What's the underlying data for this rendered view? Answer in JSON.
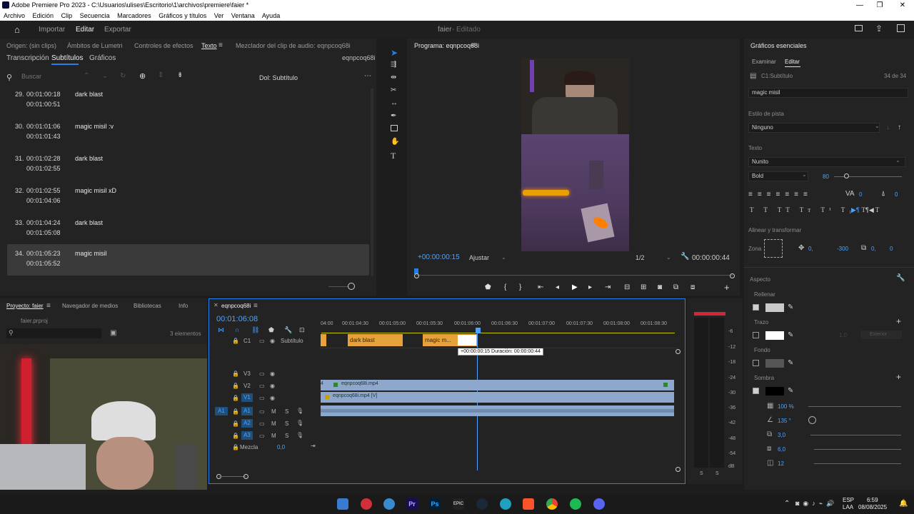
{
  "titlebar": {
    "title": "Adobe Premiere Pro 2023 - C:\\Usuarios\\ulises\\Escritorio\\1\\archivos\\premiere\\faier *"
  },
  "menu": [
    "Archivo",
    "Edición",
    "Clip",
    "Secuencia",
    "Marcadores",
    "Gráficos y títulos",
    "Ver",
    "Ventana",
    "Ayuda"
  ],
  "nav": {
    "importar": "Importar",
    "editar": "Editar",
    "exportar": "Exportar",
    "project": "faier",
    "status": "Editado"
  },
  "upper_tabs": {
    "origen": "Origen: (sin clips)",
    "ambitos": "Ámbitos de Lumetri",
    "controles": "Controles de efectos",
    "texto": "Texto",
    "mezclador": "Mezclador del clip de audio: eqnpcoq68i"
  },
  "text_panel": {
    "tab_transcripcion": "Transcripción",
    "tab_subtitulos": "Subtítulos",
    "tab_graficos": "Gráficos",
    "sequence": "eqnpcoq68i",
    "search_placeholder": "Buscar",
    "track": "Dol: Subtítulo",
    "rows": [
      {
        "num": "29.",
        "start": "00:01:00:18",
        "end": "00:01:00:51",
        "text": "dark blast"
      },
      {
        "num": "30.",
        "start": "00:01:01:06",
        "end": "00:01:01:43",
        "text": "magic misil :v"
      },
      {
        "num": "31.",
        "start": "00:01:02:28",
        "end": "00:01:02:55",
        "text": "dark blast"
      },
      {
        "num": "32.",
        "start": "00:01:02:55",
        "end": "00:01:04:06",
        "text": "magic misil xD"
      },
      {
        "num": "33.",
        "start": "00:01:04:24",
        "end": "00:01:05:08",
        "text": "dark blast"
      },
      {
        "num": "34.",
        "start": "00:01:05:23",
        "end": "00:01:05:52",
        "text": "magic misil"
      }
    ]
  },
  "program": {
    "title": "Programa: eqnpcoq68i",
    "timecode": "+00:00:00:15",
    "fit": "Ajustar",
    "res": "1/2",
    "duration": "00:00:00:44"
  },
  "essential": {
    "title": "Gráficos esenciales",
    "tab_examinar": "Examinar",
    "tab_editar": "Editar",
    "layer": "C1:Subtítulo",
    "count": "34 de 34",
    "layer_text": "magic misil",
    "estilo_label": "Estilo de pista",
    "estilo_value": "Ninguno",
    "texto_label": "Texto",
    "font": "Nunito",
    "weight": "Bold",
    "size": "80",
    "align_label": "Alinear y transformar",
    "zona": "Zona",
    "pos_x": "0,",
    "pos_y": "-300",
    "rot": "0,",
    "opacity": "0",
    "aspecto": "Aspecto",
    "rellenar": "Rellenar",
    "trazo": "Trazo",
    "fondo": "Fondo",
    "sombra": "Sombra",
    "shadow_opacity": "100 %",
    "shadow_angle": "135 °",
    "shadow_dist": "3,0",
    "shadow_size": "6,0",
    "shadow_blur": "12",
    "trazo_val": "1,0",
    "trazo_pos": "Exterior",
    "num_left": "0",
    "num_tab": "0",
    "colors": {
      "fill": "#c9c9c9",
      "stroke": "#ffffff",
      "bg": "#555555",
      "shadow": "#000000"
    }
  },
  "project_panel": {
    "tab_proyecto": "Proyecto: faier",
    "tab_nav": "Navegador de medios",
    "tab_bib": "Bibliotecas",
    "tab_info": "Info",
    "file": "faier.prproj",
    "count": "3 elementos"
  },
  "timeline": {
    "seq": "eqnpcoq68i",
    "timecode": "00:01:06:08",
    "ruler": [
      "04:00",
      "00:01:04:30",
      "00:01:05:00",
      "00:01:05:30",
      "00:01:06:00",
      "00:01:06:30",
      "00:01:07:00",
      "00:01:07:30",
      "00:01:08:00",
      "00:01:08:30"
    ],
    "c1": "C1",
    "subtitle_track": "Subtítulo",
    "clip1": "dark blast",
    "clip2": "magic m...",
    "tooltip": "+00:00:00:15 Duración: 00:00:00:44",
    "v3": "V3",
    "v2": "V2",
    "v1": "V1",
    "a1": "A1",
    "a2": "A2",
    "a3": "A3",
    "a1src": "A1",
    "v1src": "V1",
    "mezcla": "Mezcla",
    "mezcla_val": "0,0",
    "video_clip_v2": "eqnpcoq68i.mp4",
    "video_clip_v1": "eqnpcoq68i.mp4 [V]",
    "clip_v2_prefix": "4",
    "m": "M",
    "s": "S"
  },
  "meter": {
    "scale": [
      "-6",
      "-12",
      "-18",
      "-24",
      "-30",
      "-36",
      "-42",
      "-48",
      "-54",
      "dB"
    ],
    "s1": "S",
    "s2": "S"
  },
  "taskbar": {
    "lang": "ESP",
    "lang2": "LAA",
    "time": "6:59",
    "date": "08/08/2025"
  }
}
